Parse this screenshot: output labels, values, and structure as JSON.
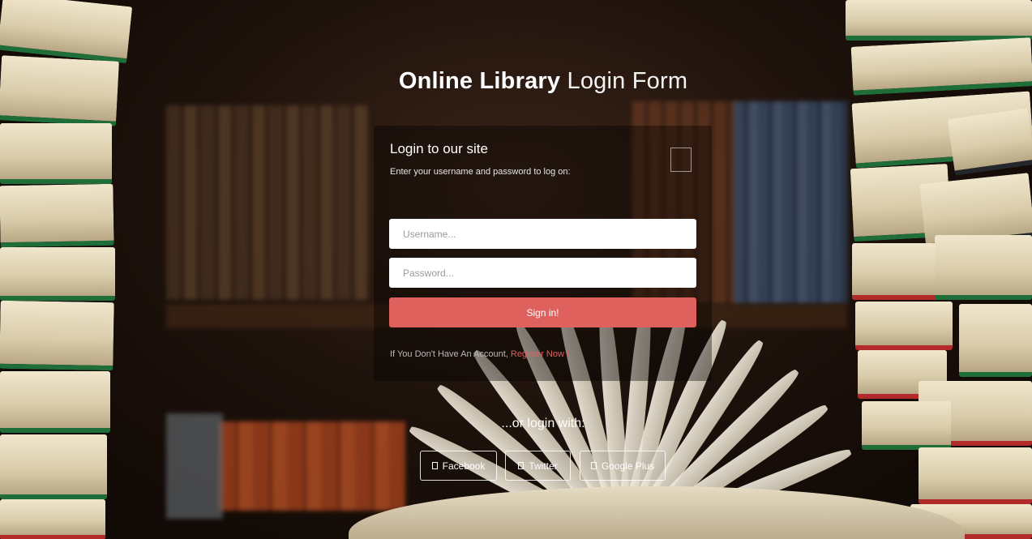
{
  "header": {
    "title_bold": "Online Library",
    "title_light": "Login Form"
  },
  "login_panel": {
    "title": "Login to our site",
    "subtitle": "Enter your username and password to log on:",
    "lock_icon": "lock-icon",
    "username_placeholder": "Username...",
    "password_placeholder": "Password...",
    "signin_label": "Sign in!",
    "register_prompt": "If You Don't Have An Account, ",
    "register_link": "Register Now !"
  },
  "social": {
    "heading": "...or login with:",
    "buttons": [
      {
        "label": "Facebook",
        "icon": "facebook-icon"
      },
      {
        "label": "Twitter",
        "icon": "twitter-icon"
      },
      {
        "label": "Google Plus",
        "icon": "google-plus-icon"
      }
    ]
  },
  "colors": {
    "accent": "#de615e",
    "panel_bg": "rgba(0,0,0,0.38)",
    "text": "#ffffff"
  }
}
